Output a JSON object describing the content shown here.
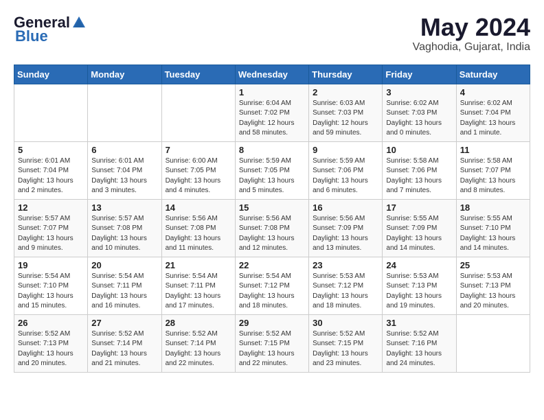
{
  "logo": {
    "general": "General",
    "blue": "Blue"
  },
  "title": {
    "month_year": "May 2024",
    "location": "Vaghodia, Gujarat, India"
  },
  "days_of_week": [
    "Sunday",
    "Monday",
    "Tuesday",
    "Wednesday",
    "Thursday",
    "Friday",
    "Saturday"
  ],
  "weeks": [
    [
      {
        "day": "",
        "content": ""
      },
      {
        "day": "",
        "content": ""
      },
      {
        "day": "",
        "content": ""
      },
      {
        "day": "1",
        "content": "Sunrise: 6:04 AM\nSunset: 7:02 PM\nDaylight: 12 hours\nand 58 minutes."
      },
      {
        "day": "2",
        "content": "Sunrise: 6:03 AM\nSunset: 7:03 PM\nDaylight: 12 hours\nand 59 minutes."
      },
      {
        "day": "3",
        "content": "Sunrise: 6:02 AM\nSunset: 7:03 PM\nDaylight: 13 hours\nand 0 minutes."
      },
      {
        "day": "4",
        "content": "Sunrise: 6:02 AM\nSunset: 7:04 PM\nDaylight: 13 hours\nand 1 minute."
      }
    ],
    [
      {
        "day": "5",
        "content": "Sunrise: 6:01 AM\nSunset: 7:04 PM\nDaylight: 13 hours\nand 2 minutes."
      },
      {
        "day": "6",
        "content": "Sunrise: 6:01 AM\nSunset: 7:04 PM\nDaylight: 13 hours\nand 3 minutes."
      },
      {
        "day": "7",
        "content": "Sunrise: 6:00 AM\nSunset: 7:05 PM\nDaylight: 13 hours\nand 4 minutes."
      },
      {
        "day": "8",
        "content": "Sunrise: 5:59 AM\nSunset: 7:05 PM\nDaylight: 13 hours\nand 5 minutes."
      },
      {
        "day": "9",
        "content": "Sunrise: 5:59 AM\nSunset: 7:06 PM\nDaylight: 13 hours\nand 6 minutes."
      },
      {
        "day": "10",
        "content": "Sunrise: 5:58 AM\nSunset: 7:06 PM\nDaylight: 13 hours\nand 7 minutes."
      },
      {
        "day": "11",
        "content": "Sunrise: 5:58 AM\nSunset: 7:07 PM\nDaylight: 13 hours\nand 8 minutes."
      }
    ],
    [
      {
        "day": "12",
        "content": "Sunrise: 5:57 AM\nSunset: 7:07 PM\nDaylight: 13 hours\nand 9 minutes."
      },
      {
        "day": "13",
        "content": "Sunrise: 5:57 AM\nSunset: 7:08 PM\nDaylight: 13 hours\nand 10 minutes."
      },
      {
        "day": "14",
        "content": "Sunrise: 5:56 AM\nSunset: 7:08 PM\nDaylight: 13 hours\nand 11 minutes."
      },
      {
        "day": "15",
        "content": "Sunrise: 5:56 AM\nSunset: 7:08 PM\nDaylight: 13 hours\nand 12 minutes."
      },
      {
        "day": "16",
        "content": "Sunrise: 5:56 AM\nSunset: 7:09 PM\nDaylight: 13 hours\nand 13 minutes."
      },
      {
        "day": "17",
        "content": "Sunrise: 5:55 AM\nSunset: 7:09 PM\nDaylight: 13 hours\nand 14 minutes."
      },
      {
        "day": "18",
        "content": "Sunrise: 5:55 AM\nSunset: 7:10 PM\nDaylight: 13 hours\nand 14 minutes."
      }
    ],
    [
      {
        "day": "19",
        "content": "Sunrise: 5:54 AM\nSunset: 7:10 PM\nDaylight: 13 hours\nand 15 minutes."
      },
      {
        "day": "20",
        "content": "Sunrise: 5:54 AM\nSunset: 7:11 PM\nDaylight: 13 hours\nand 16 minutes."
      },
      {
        "day": "21",
        "content": "Sunrise: 5:54 AM\nSunset: 7:11 PM\nDaylight: 13 hours\nand 17 minutes."
      },
      {
        "day": "22",
        "content": "Sunrise: 5:54 AM\nSunset: 7:12 PM\nDaylight: 13 hours\nand 18 minutes."
      },
      {
        "day": "23",
        "content": "Sunrise: 5:53 AM\nSunset: 7:12 PM\nDaylight: 13 hours\nand 18 minutes."
      },
      {
        "day": "24",
        "content": "Sunrise: 5:53 AM\nSunset: 7:13 PM\nDaylight: 13 hours\nand 19 minutes."
      },
      {
        "day": "25",
        "content": "Sunrise: 5:53 AM\nSunset: 7:13 PM\nDaylight: 13 hours\nand 20 minutes."
      }
    ],
    [
      {
        "day": "26",
        "content": "Sunrise: 5:52 AM\nSunset: 7:13 PM\nDaylight: 13 hours\nand 20 minutes."
      },
      {
        "day": "27",
        "content": "Sunrise: 5:52 AM\nSunset: 7:14 PM\nDaylight: 13 hours\nand 21 minutes."
      },
      {
        "day": "28",
        "content": "Sunrise: 5:52 AM\nSunset: 7:14 PM\nDaylight: 13 hours\nand 22 minutes."
      },
      {
        "day": "29",
        "content": "Sunrise: 5:52 AM\nSunset: 7:15 PM\nDaylight: 13 hours\nand 22 minutes."
      },
      {
        "day": "30",
        "content": "Sunrise: 5:52 AM\nSunset: 7:15 PM\nDaylight: 13 hours\nand 23 minutes."
      },
      {
        "day": "31",
        "content": "Sunrise: 5:52 AM\nSunset: 7:16 PM\nDaylight: 13 hours\nand 24 minutes."
      },
      {
        "day": "",
        "content": ""
      }
    ]
  ]
}
